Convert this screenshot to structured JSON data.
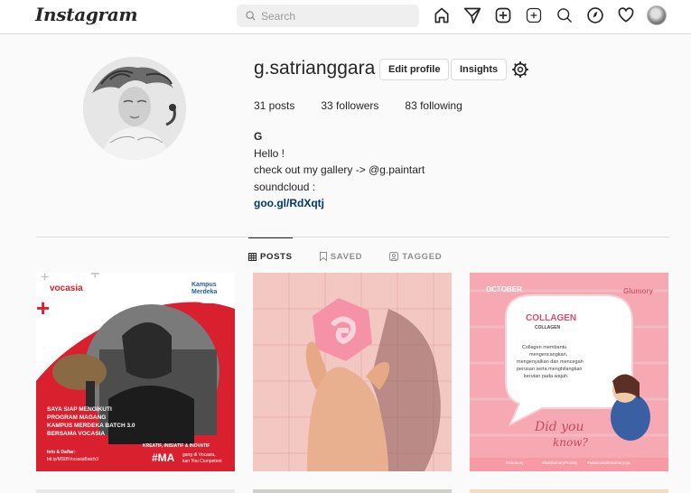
{
  "header": {
    "logo": "Instagram",
    "search_placeholder": "Search",
    "nav_icons": [
      "home-icon",
      "direct-icon",
      "new-post-icon",
      "add-icon",
      "explore-search-icon",
      "explore-compass-icon",
      "activity-heart-icon",
      "profile-avatar"
    ]
  },
  "profile": {
    "username": "g.satrianggara",
    "edit_profile_label": "Edit profile",
    "insights_label": "Insights",
    "stats": {
      "posts": "31 posts",
      "followers": "33 followers",
      "following": "83 following"
    },
    "bio": {
      "name": "G",
      "line1": "Hello !",
      "line2": "check out my gallery -> @g.paintart",
      "line3": "soundcloud :",
      "link": "goo.gl/RdXqtj"
    }
  },
  "tabs": [
    {
      "label": "POSTS",
      "active": true,
      "icon": "grid-icon"
    },
    {
      "label": "SAVED",
      "active": false,
      "icon": "bookmark-icon"
    },
    {
      "label": "TAGGED",
      "active": false,
      "icon": "tag-icon"
    }
  ],
  "posts": [
    {
      "brand": "vocasia",
      "badge_line1": "Kampus",
      "badge_line2": "Merdeka",
      "caption_line1": "SAYA SIAP MENGIKUTI",
      "caption_line2": "PROGRAM MAGANG",
      "caption_line3": "KAMPUS MERDEKA BATCH 3.0",
      "caption_line4": "BERSAMA VOCASIA",
      "tagline": "KREATIF, INISIATIF & INOVATIF",
      "info_line1": "Info & Daftar:",
      "info_line2": "bit.ly/MSIBVocasiaBatch3",
      "hashtag": "#MA",
      "hashtag_sub1": "gang di Vocasia,",
      "hashtag_sub2": "kan You Competent"
    },
    {},
    {
      "corner": "OCTOBER",
      "brand": "Glumory",
      "title": "COLLAGEN",
      "subtitle": "COLLAGEN",
      "body1": "Collagen membantu",
      "body2": "mengencangkan,",
      "body3": "mengenyalkan dan mencegah",
      "body4": "perusan serta menghilangkan",
      "body5": "kerutan pada wajah.",
      "script1": "Did you",
      "script2": "know?",
      "footer1": "#Glumory",
      "footer2": "#BeGlumoryPriority",
      "footer3": "#MauCantikGlumoryAja"
    }
  ],
  "colors": {
    "accent_link": "#00376b",
    "vocasia_red": "#d8202f",
    "collagen_pink": "#f6a9b2"
  }
}
